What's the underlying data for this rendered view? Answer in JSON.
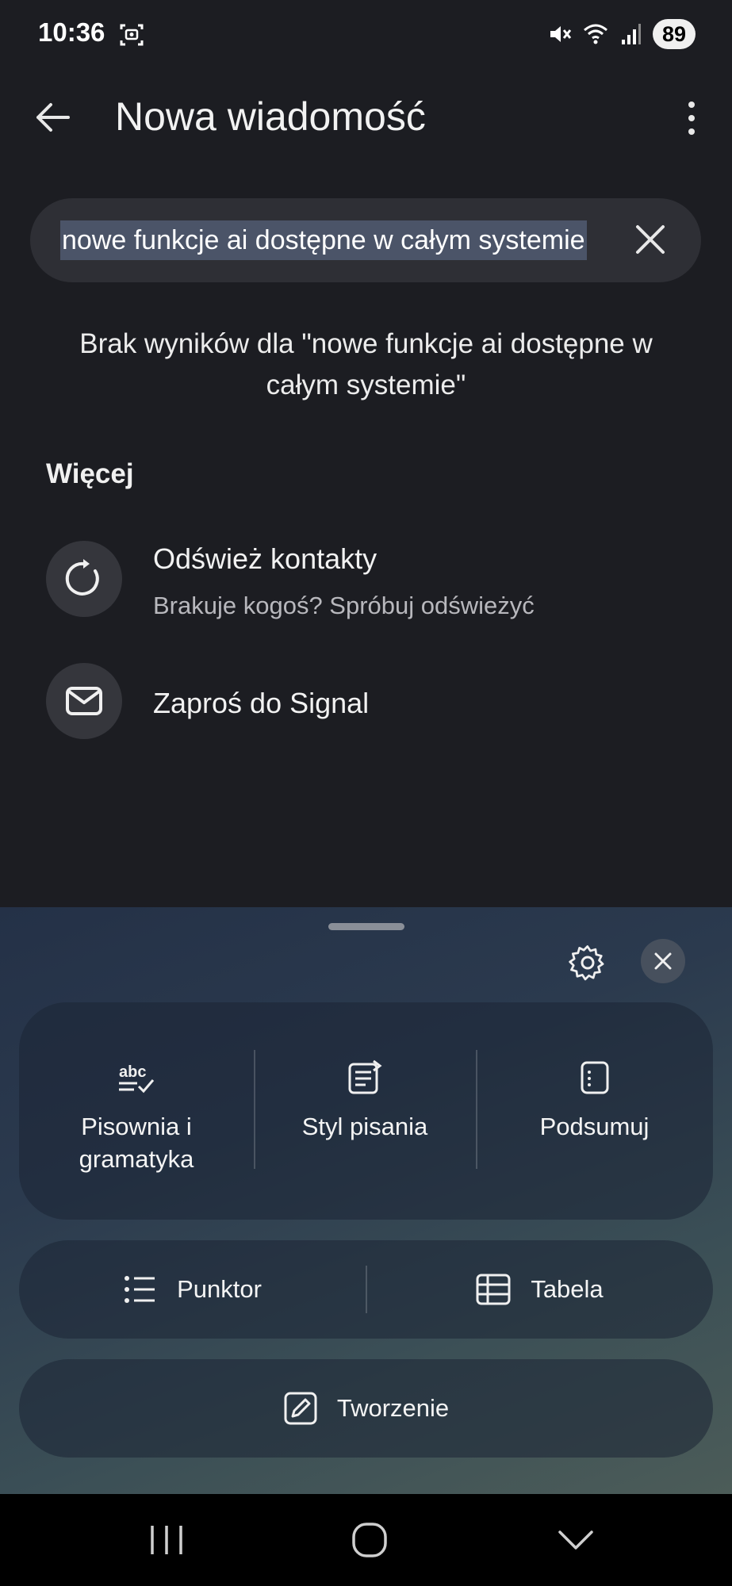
{
  "status_bar": {
    "time": "10:36",
    "battery": "89"
  },
  "header": {
    "title": "Nowa wiadomość"
  },
  "search": {
    "value": "nowe funkcje ai dostępne w całym systemie"
  },
  "results": {
    "empty_message": "Brak wyników dla \"nowe funkcje ai dostępne w całym systemie\""
  },
  "more_section": {
    "heading": "Więcej",
    "items": [
      {
        "title": "Odśwież kontakty",
        "subtitle": "Brakuje kogoś? Spróbuj odświeżyć",
        "icon": "refresh-icon"
      },
      {
        "title": "Zaproś do Signal",
        "icon": "mail-icon"
      }
    ]
  },
  "ai_panel": {
    "tools": [
      {
        "label": "Pisownia i gramatyka",
        "icon": "spell-check-icon"
      },
      {
        "label": "Styl pisania",
        "icon": "writing-style-icon"
      },
      {
        "label": "Podsumuj",
        "icon": "summary-icon"
      }
    ],
    "format_buttons": [
      {
        "label": "Punktor",
        "icon": "bullet-list-icon"
      },
      {
        "label": "Tabela",
        "icon": "table-icon"
      }
    ],
    "compose": {
      "label": "Tworzenie",
      "icon": "compose-icon"
    }
  }
}
